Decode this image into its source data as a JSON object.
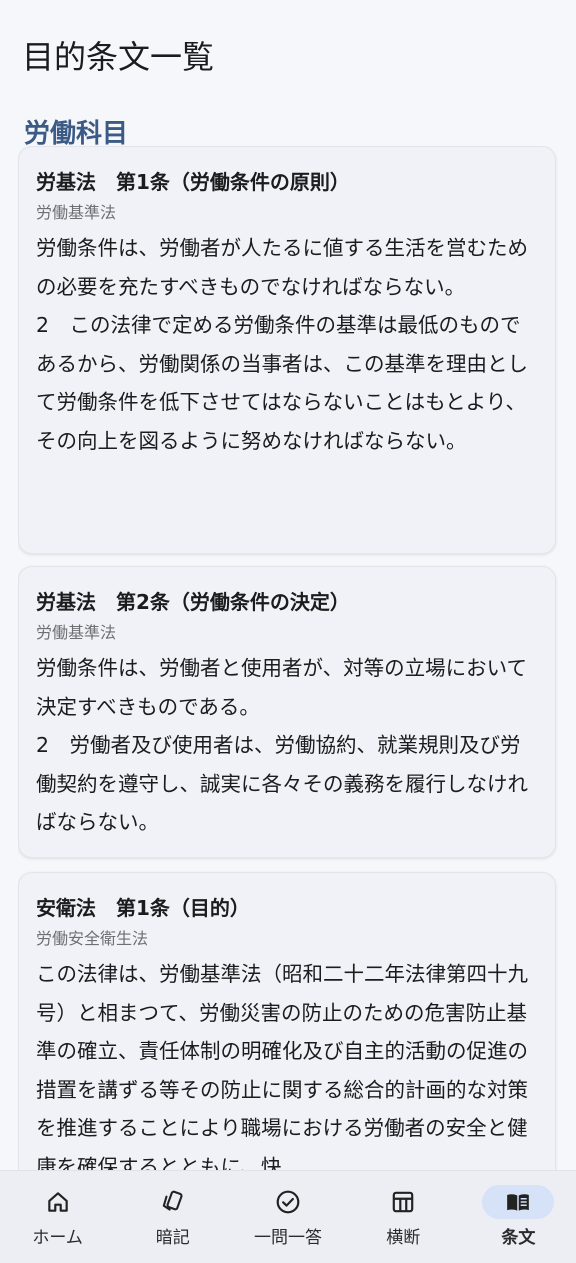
{
  "page": {
    "title": "目的条文一覧",
    "section_title": "労働科目"
  },
  "cards": [
    {
      "title": "労基法　第1条（労働条件の原則）",
      "law": "労働基準法",
      "body": "労働条件は、労働者が人たるに値する生活を営むための必要を充たすべきものでなければならない。\n2　この法律で定める労働条件の基準は最低のものであるから、労働関係の当事者は、この基準を理由として労働条件を低下させてはならないことはもとより、その向上を図るように努めなければならない。"
    },
    {
      "title": "労基法　第2条（労働条件の決定）",
      "law": "労働基準法",
      "body": "労働条件は、労働者と使用者が、対等の立場において決定すべきものである。\n2　労働者及び使用者は、労働協約、就業規則及び労働契約を遵守し、誠実に各々その義務を履行しなければならない。"
    },
    {
      "title": "安衛法　第1条（目的）",
      "law": "労働安全衛生法",
      "body": "この法律は、労働基準法（昭和二十二年法律第四十九号）と相まつて、労働災害の防止のための危害防止基準の確立、責任体制の明確化及び自主的活動の促進の措置を講ずる等その防止に関する総合的計画的な対策を推進することにより職場における労働者の安全と健康を確保するとともに、快"
    }
  ],
  "nav": {
    "items": [
      {
        "label": "ホーム",
        "icon": "home-icon"
      },
      {
        "label": "暗記",
        "icon": "cards-icon"
      },
      {
        "label": "一問一答",
        "icon": "check-circle-icon"
      },
      {
        "label": "横断",
        "icon": "table-icon"
      },
      {
        "label": "条文",
        "icon": "book-icon"
      }
    ],
    "active": "条文",
    "active_color": "#d6e2f7"
  },
  "colors": {
    "background": "#f6f7fb",
    "section_title": "#3b5b86",
    "card_background": "#f1f2f7"
  }
}
